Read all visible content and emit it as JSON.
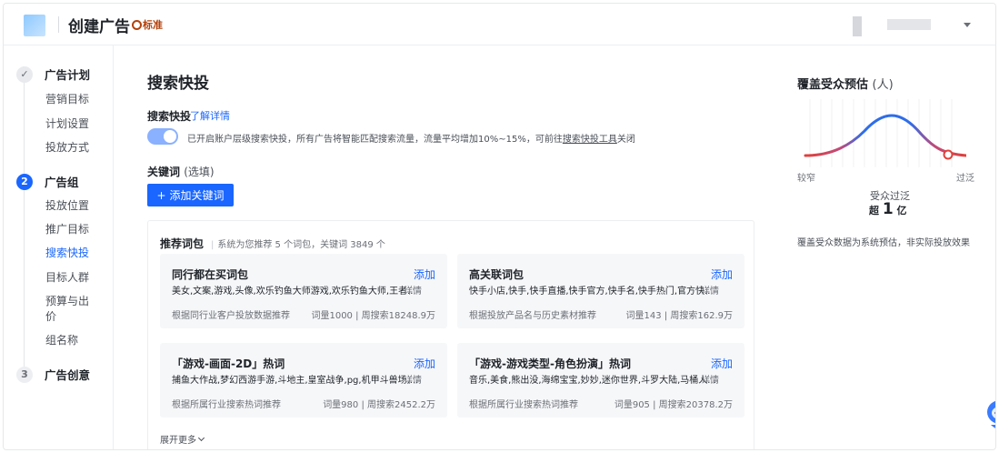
{
  "header": {
    "title": "创建广告",
    "badge": "标准"
  },
  "sidebar": {
    "steps": [
      {
        "num": "✓",
        "label": "广告计划",
        "items": [
          "营销目标",
          "计划设置",
          "投放方式"
        ]
      },
      {
        "num": "2",
        "label": "广告组",
        "items": [
          "投放位置",
          "推广目标",
          "搜索快投",
          "目标人群",
          "预算与出价",
          "组名称"
        ]
      },
      {
        "num": "3",
        "label": "广告创意",
        "items": []
      }
    ],
    "current_item": "搜索快投"
  },
  "main": {
    "title": "搜索快投",
    "section_label": "搜索快投",
    "learn_more": "了解详情",
    "toggle_on": true,
    "toggle_text_before": "已开启账户层级搜索快投，所有广告将智能匹配搜索流量，流量平均增加10%~15%，可前往",
    "toggle_link": "搜索快投工具",
    "toggle_text_after": "关闭",
    "keyword_label": "关键词",
    "keyword_optional": "(选填)",
    "add_keyword_button": "添加关键词",
    "recommend": {
      "title": "推荐词包",
      "desc": "系统为您推荐 5 个词包，关键词 3849 个",
      "cards": [
        {
          "title": "同行都在买词包",
          "add": "添加",
          "keywords": "美女,文案,游戏,头像,欢乐钓鱼大师游戏,欢乐钓鱼大师,王者...",
          "detail": "详情",
          "source": "根据同行业客户投放数据推荐",
          "stat": "词量1000 | 周搜索18248.9万"
        },
        {
          "title": "高关联词包",
          "add": "添加",
          "keywords": "快手小店,快手,快手直播,快手官方,快手名,快手热门,官方快...",
          "detail": "详情",
          "source": "根据投放产品名与历史素材推荐",
          "stat": "词量143 | 周搜索162.9万"
        },
        {
          "title": "「游戏-画面-2D」热词",
          "add": "添加",
          "keywords": "捕鱼大作战,梦幻西游手游,斗地主,皇室战争,pg,机甲斗兽场,...",
          "detail": "详情",
          "source": "根据所属行业搜索热词推荐",
          "stat": "词量980 | 周搜索2452.2万"
        },
        {
          "title": "「游戏-游戏类型-角色扮演」热词",
          "add": "添加",
          "keywords": "音乐,美食,熊出没,海绵宝宝,妙妙,迷你世界,斗罗大陆,马桶人...",
          "detail": "详情",
          "source": "根据所属行业搜索热词推荐",
          "stat": "词量905 | 周搜索20378.2万"
        }
      ],
      "expand_more": "展开更多"
    }
  },
  "right": {
    "title": "覆盖受众预估",
    "unit": "(人)",
    "label_narrow": "较窄",
    "label_wide": "过泛",
    "status": "受众过泛",
    "value_prefix": "超",
    "value_num": "1",
    "value_unit": "亿",
    "note": "覆盖受众数据为系统预估，非实际投放效果",
    "indicator_level": 0.9
  },
  "colors": {
    "accent": "#1a66ff",
    "curve_blue": "#2f6de8",
    "curve_red": "#e0413a"
  }
}
